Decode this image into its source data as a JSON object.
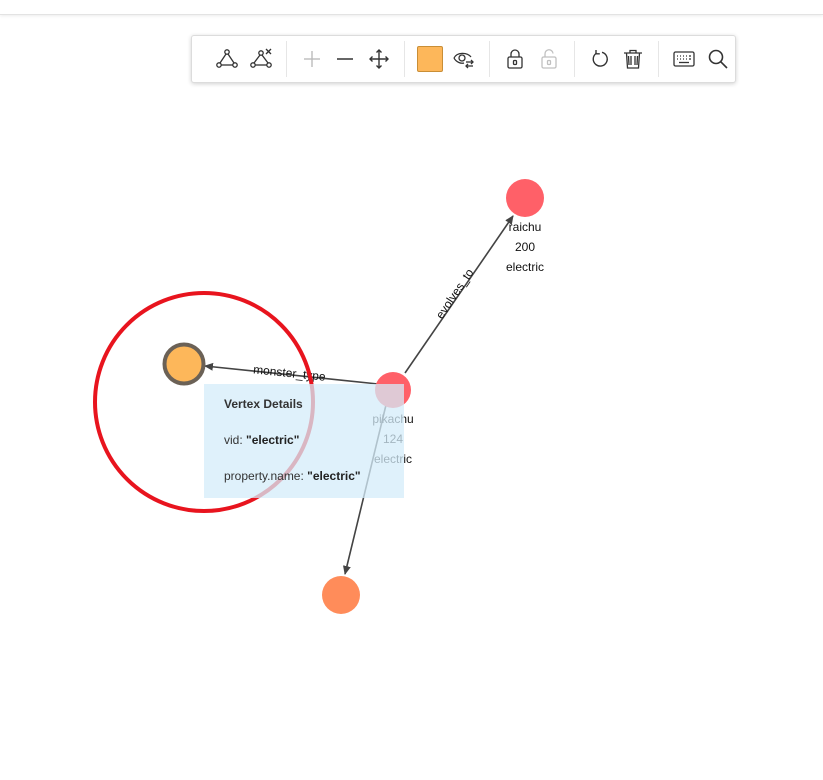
{
  "toolbar": {
    "buttons": [
      {
        "name": "add-edge-button",
        "icon": "triangle-nodes-icon"
      },
      {
        "name": "remove-edge-button",
        "icon": "triangle-nodes-x-icon"
      },
      {
        "name": "zoom-in-button",
        "icon": "plus-icon"
      },
      {
        "name": "zoom-out-button",
        "icon": "minus-icon"
      },
      {
        "name": "pan-button",
        "icon": "move-arrows-icon"
      },
      {
        "name": "color-button",
        "icon": "color-swatch",
        "color": "#FDB75A"
      },
      {
        "name": "toggle-visibility-button",
        "icon": "eye-swap-icon"
      },
      {
        "name": "lock-button",
        "icon": "lock-icon"
      },
      {
        "name": "unlock-button",
        "icon": "unlock-icon"
      },
      {
        "name": "refresh-button",
        "icon": "rotate-icon"
      },
      {
        "name": "delete-button",
        "icon": "trash-icon"
      },
      {
        "name": "keyboard-button",
        "icon": "keyboard-icon"
      },
      {
        "name": "search-button",
        "icon": "search-icon"
      }
    ]
  },
  "graph": {
    "nodes": [
      {
        "id": "electric",
        "color": "#FDB75A",
        "labels": []
      },
      {
        "id": "raichu",
        "color": "#FF6068",
        "labels": [
          "raichu",
          "200",
          "electric"
        ]
      },
      {
        "id": "pikachu",
        "color": "#FF6068",
        "labels": [
          "pikachu",
          "124",
          "electric"
        ]
      },
      {
        "id": "bottom-node",
        "color": "#FF8C5A",
        "labels": []
      }
    ],
    "edges": [
      {
        "from": "pikachu",
        "to": "raichu",
        "label": "evolves_to"
      },
      {
        "from": "pikachu",
        "to": "electric",
        "label": "monster_type"
      },
      {
        "from": "pikachu",
        "to": "bottom-node",
        "label": ""
      }
    ],
    "highlight_color": "#E8141E"
  },
  "tooltip": {
    "title": "Vertex Details",
    "vid_label": "vid: ",
    "vid_value": "\"electric\"",
    "prop_label": "property.name: ",
    "prop_value": "\"electric\""
  }
}
